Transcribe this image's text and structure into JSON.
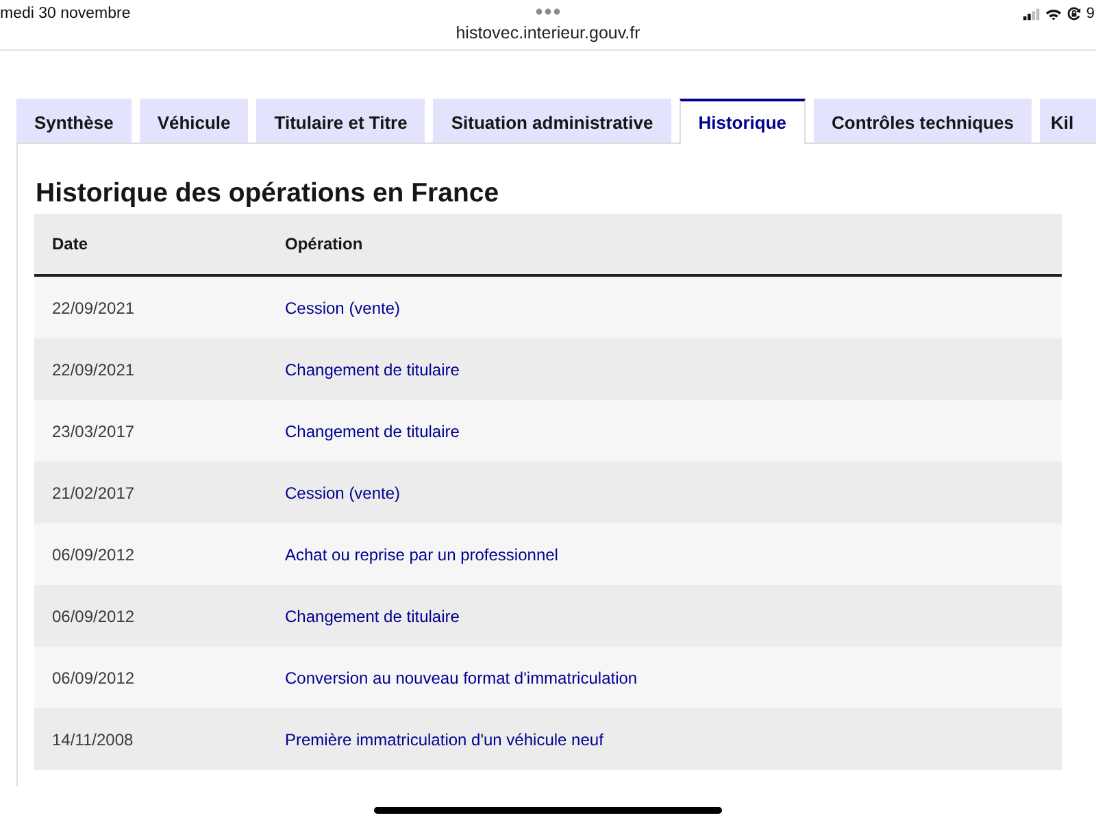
{
  "status_bar": {
    "date": "medi 30 novembre",
    "battery": "9"
  },
  "browser": {
    "url": "histovec.interieur.gouv.fr"
  },
  "tabs": [
    {
      "label": "Synthèse",
      "selected": false
    },
    {
      "label": "Véhicule",
      "selected": false
    },
    {
      "label": "Titulaire et Titre",
      "selected": false
    },
    {
      "label": "Situation administrative",
      "selected": false
    },
    {
      "label": "Historique",
      "selected": true
    },
    {
      "label": "Contrôles techniques",
      "selected": false
    },
    {
      "label": "Kil",
      "selected": false
    }
  ],
  "section": {
    "title": "Historique des opérations en France"
  },
  "table": {
    "columns": [
      "Date",
      "Opération"
    ],
    "rows": [
      {
        "date": "22/09/2021",
        "operation": "Cession (vente)"
      },
      {
        "date": "22/09/2021",
        "operation": "Changement de titulaire"
      },
      {
        "date": "23/03/2017",
        "operation": "Changement de titulaire"
      },
      {
        "date": "21/02/2017",
        "operation": "Cession (vente)"
      },
      {
        "date": "06/09/2012",
        "operation": "Achat ou reprise par un professionnel"
      },
      {
        "date": "06/09/2012",
        "operation": "Changement de titulaire"
      },
      {
        "date": "06/09/2012",
        "operation": "Conversion au nouveau format d'immatriculation"
      },
      {
        "date": "14/11/2008",
        "operation": "Première immatriculation d'un véhicule neuf"
      }
    ]
  }
}
